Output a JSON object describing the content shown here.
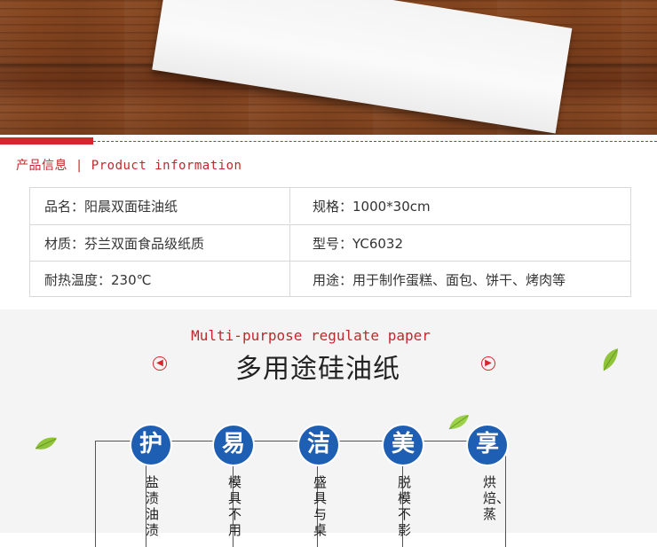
{
  "banner": {
    "description_icon": "wood-table-with-parchment-paper"
  },
  "section_title": "产品信息 | Product information",
  "info": {
    "rows": [
      {
        "left": "品名：阳晨双面硅油纸",
        "right": "规格：1000*30cm"
      },
      {
        "left": "材质：芬兰双面食品级纸质",
        "right": "型号：YC6032"
      },
      {
        "left": "耐热温度：230℃",
        "right": "用途：用于制作蛋糕、面包、饼干、烤肉等"
      }
    ]
  },
  "purpose": {
    "subtitle_en": "Multi-purpose regulate paper",
    "title_cn": "多用途硅油纸",
    "prev_icon": "chevron-left-icon",
    "next_icon": "chevron-right-icon"
  },
  "features": [
    {
      "char": "护",
      "text": "盐渍油渍"
    },
    {
      "char": "易",
      "text": "模具不用"
    },
    {
      "char": "洁",
      "text": "盛具与桌"
    },
    {
      "char": "美",
      "text": "脱模不影"
    },
    {
      "char": "享",
      "text": "烘焙、蒸"
    }
  ],
  "colors": {
    "accent": "#d7262a",
    "badge": "#1f5fb3",
    "leaf": "#8fc43a"
  }
}
